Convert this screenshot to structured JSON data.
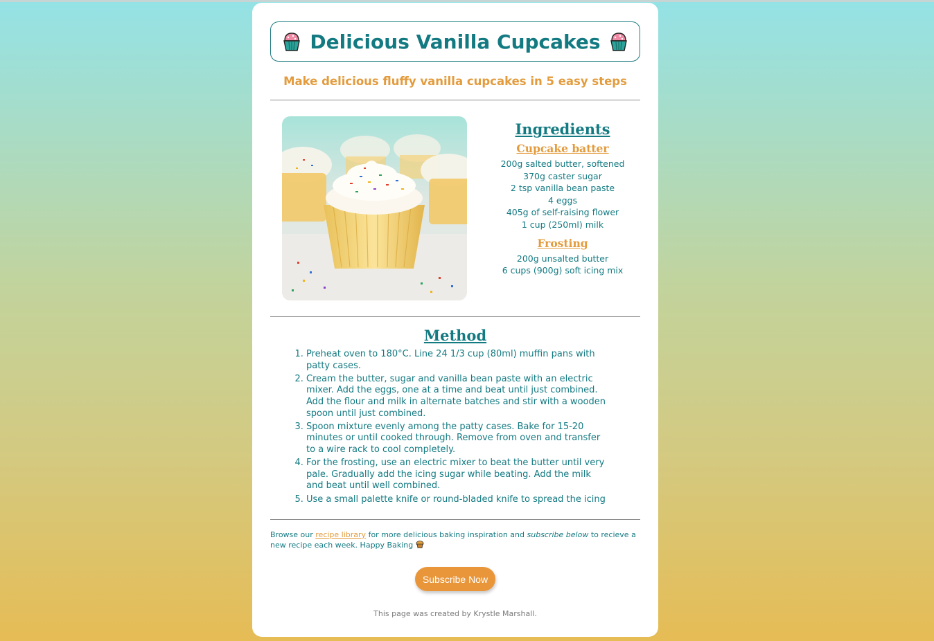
{
  "header": {
    "title": "Delicious Vanilla Cupcakes",
    "subtitle": "Make delicious fluffy vanilla cupcakes in 5 easy steps",
    "title_icon": "cupcake-icon"
  },
  "photo": {
    "description_icon": "cupcake-photo"
  },
  "ingredients": {
    "heading": "Ingredients",
    "batter_heading": "Cupcake batter",
    "batter": [
      "200g salted butter, softened",
      "370g caster sugar",
      "2 tsp vanilla bean paste",
      "4 eggs",
      "405g of self-raising flower",
      "1 cup (250ml) milk"
    ],
    "frosting_heading": "Frosting",
    "frosting": [
      "200g unsalted butter",
      "6 cups (900g) soft icing mix"
    ]
  },
  "method": {
    "heading": "Method",
    "steps": [
      "Preheat oven to 180°C. Line 24 1/3 cup (80ml) muffin pans with patty cases.",
      "Cream the butter, sugar and vanilla bean paste with an electric mixer. Add the eggs, one at a time and beat until just combined. Add the flour and milk in alternate batches and stir with a wooden spoon until just combined.",
      "Spoon mixture evenly among the patty cases. Bake for 15-20 minutes or until cooked through. Remove from oven and transfer to a wire rack to cool completely.",
      "For the frosting, use an electric mixer to beat the butter until very pale. Gradually add the icing sugar while beating. Add the milk and beat until well combined.",
      "Use a small palette knife or round-bladed knife to spread the icing"
    ]
  },
  "footer": {
    "browse_prefix": "Browse our ",
    "library_link": "recipe library",
    "browse_middle": " for more delicious baking inspiration and ",
    "subscribe_em": "subscribe below",
    "browse_suffix": " to recieve a new recipe each week. Happy Baking ",
    "baking_icon": "muffin-icon",
    "subscribe_button": "Subscribe Now",
    "credit": "This page was created by Krystle Marshall."
  },
  "colors": {
    "teal": "#137a82",
    "orange": "#e39b3c",
    "button": "#e9963a"
  }
}
